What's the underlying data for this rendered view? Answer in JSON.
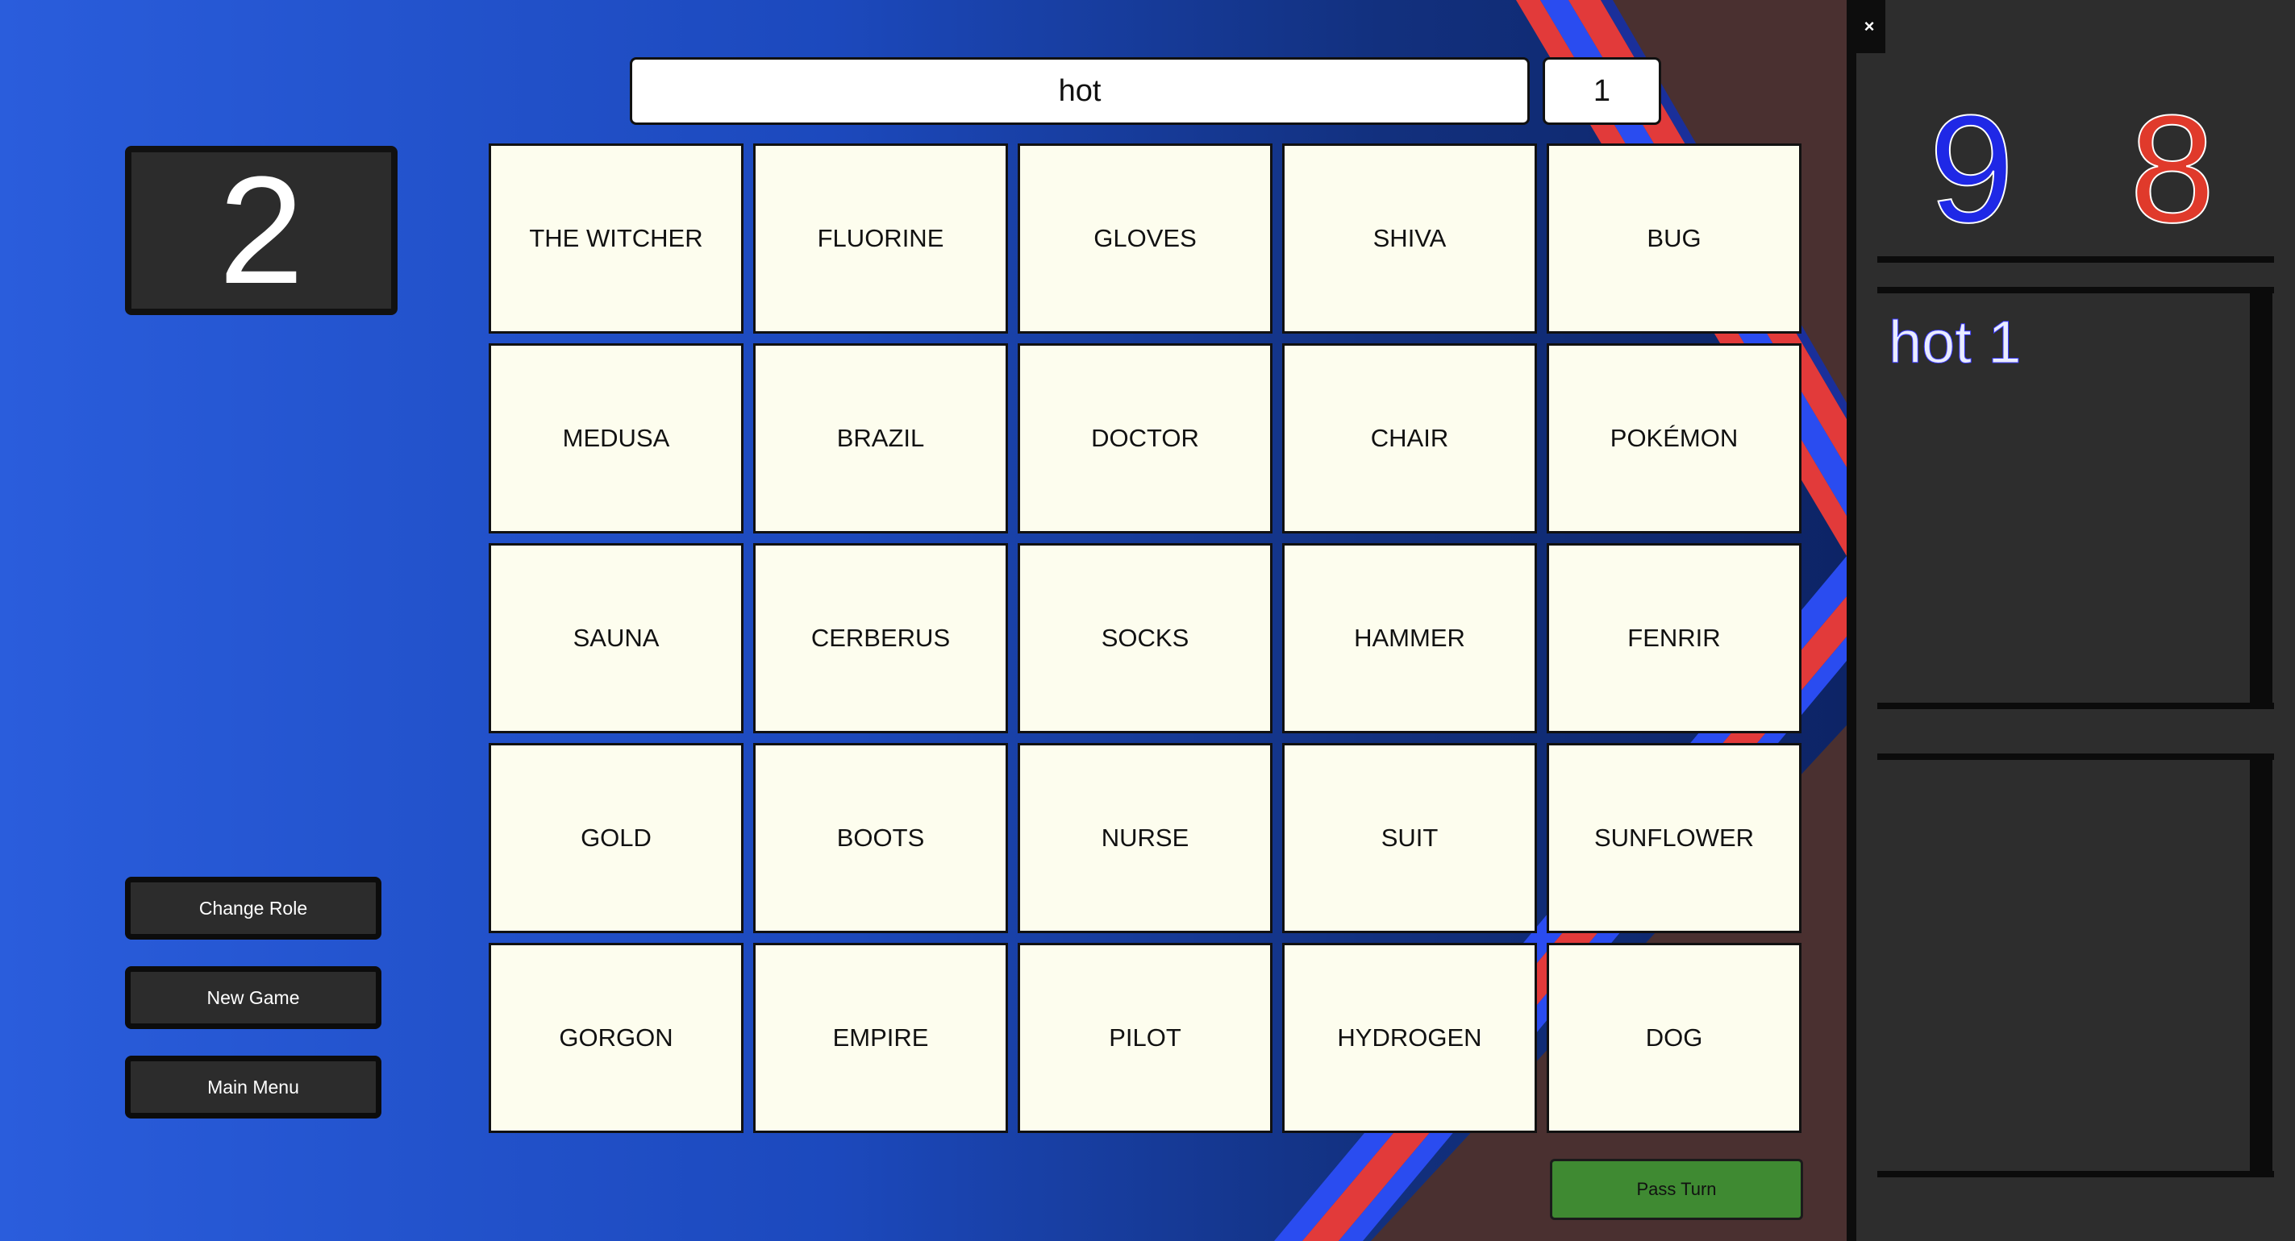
{
  "clue": {
    "word": "hot",
    "number": "1"
  },
  "guess_counter": "2",
  "buttons": {
    "change_role": "Change Role",
    "new_game": "New Game",
    "main_menu": "Main Menu",
    "pass_turn": "Pass Turn",
    "close": "×"
  },
  "board": {
    "cards": [
      "THE WITCHER",
      "FLUORINE",
      "GLOVES",
      "SHIVA",
      "BUG",
      "MEDUSA",
      "BRAZIL",
      "DOCTOR",
      "CHAIR",
      "POKÉMON",
      "SAUNA",
      "CERBERUS",
      "SOCKS",
      "HAMMER",
      "FENRIR",
      "GOLD",
      "BOOTS",
      "NURSE",
      "SUIT",
      "SUNFLOWER",
      "GORGON",
      "EMPIRE",
      "PILOT",
      "HYDROGEN",
      "DOG"
    ]
  },
  "scores": {
    "blue": "9",
    "red": "8"
  },
  "clue_log": [
    "hot 1"
  ],
  "colors": {
    "blue_team": "#1f28e6",
    "red_team": "#e03a2b",
    "card": "#fdfdee",
    "pass_turn": "#3f8a32",
    "panel": "#2d2d2d",
    "background_blue": "#2a5bd8",
    "background_brown": "#4a3030"
  }
}
